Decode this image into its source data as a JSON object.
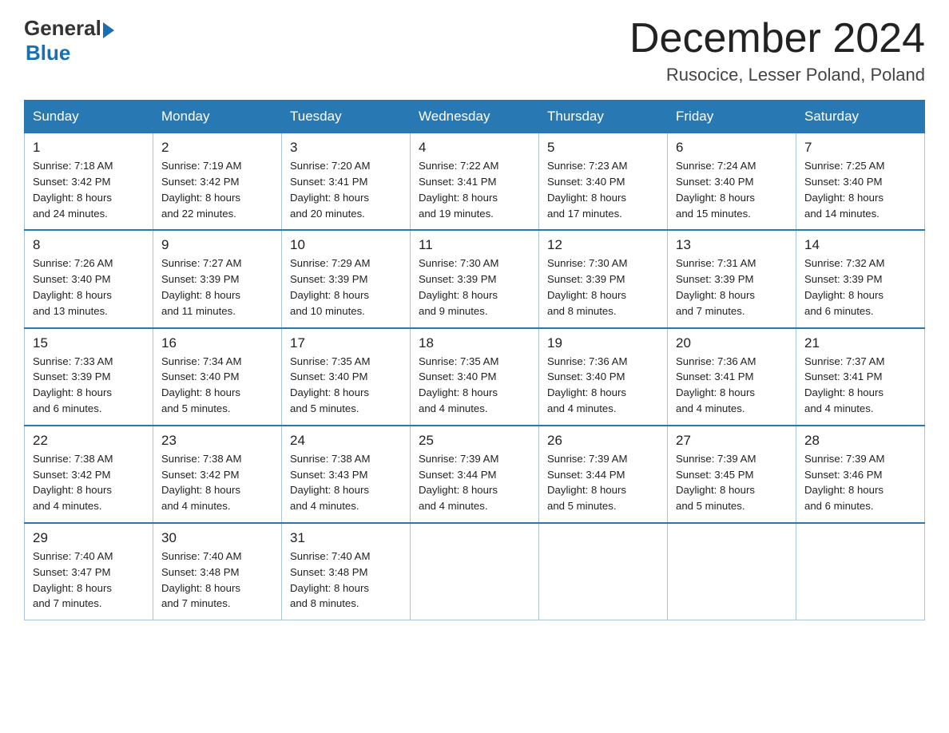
{
  "header": {
    "logo_general": "General",
    "logo_blue": "Blue",
    "title": "December 2024",
    "subtitle": "Rusocice, Lesser Poland, Poland"
  },
  "days_of_week": [
    "Sunday",
    "Monday",
    "Tuesday",
    "Wednesday",
    "Thursday",
    "Friday",
    "Saturday"
  ],
  "weeks": [
    [
      {
        "day": "1",
        "sunrise": "7:18 AM",
        "sunset": "3:42 PM",
        "daylight": "8 hours and 24 minutes."
      },
      {
        "day": "2",
        "sunrise": "7:19 AM",
        "sunset": "3:42 PM",
        "daylight": "8 hours and 22 minutes."
      },
      {
        "day": "3",
        "sunrise": "7:20 AM",
        "sunset": "3:41 PM",
        "daylight": "8 hours and 20 minutes."
      },
      {
        "day": "4",
        "sunrise": "7:22 AM",
        "sunset": "3:41 PM",
        "daylight": "8 hours and 19 minutes."
      },
      {
        "day": "5",
        "sunrise": "7:23 AM",
        "sunset": "3:40 PM",
        "daylight": "8 hours and 17 minutes."
      },
      {
        "day": "6",
        "sunrise": "7:24 AM",
        "sunset": "3:40 PM",
        "daylight": "8 hours and 15 minutes."
      },
      {
        "day": "7",
        "sunrise": "7:25 AM",
        "sunset": "3:40 PM",
        "daylight": "8 hours and 14 minutes."
      }
    ],
    [
      {
        "day": "8",
        "sunrise": "7:26 AM",
        "sunset": "3:40 PM",
        "daylight": "8 hours and 13 minutes."
      },
      {
        "day": "9",
        "sunrise": "7:27 AM",
        "sunset": "3:39 PM",
        "daylight": "8 hours and 11 minutes."
      },
      {
        "day": "10",
        "sunrise": "7:29 AM",
        "sunset": "3:39 PM",
        "daylight": "8 hours and 10 minutes."
      },
      {
        "day": "11",
        "sunrise": "7:30 AM",
        "sunset": "3:39 PM",
        "daylight": "8 hours and 9 minutes."
      },
      {
        "day": "12",
        "sunrise": "7:30 AM",
        "sunset": "3:39 PM",
        "daylight": "8 hours and 8 minutes."
      },
      {
        "day": "13",
        "sunrise": "7:31 AM",
        "sunset": "3:39 PM",
        "daylight": "8 hours and 7 minutes."
      },
      {
        "day": "14",
        "sunrise": "7:32 AM",
        "sunset": "3:39 PM",
        "daylight": "8 hours and 6 minutes."
      }
    ],
    [
      {
        "day": "15",
        "sunrise": "7:33 AM",
        "sunset": "3:39 PM",
        "daylight": "8 hours and 6 minutes."
      },
      {
        "day": "16",
        "sunrise": "7:34 AM",
        "sunset": "3:40 PM",
        "daylight": "8 hours and 5 minutes."
      },
      {
        "day": "17",
        "sunrise": "7:35 AM",
        "sunset": "3:40 PM",
        "daylight": "8 hours and 5 minutes."
      },
      {
        "day": "18",
        "sunrise": "7:35 AM",
        "sunset": "3:40 PM",
        "daylight": "8 hours and 4 minutes."
      },
      {
        "day": "19",
        "sunrise": "7:36 AM",
        "sunset": "3:40 PM",
        "daylight": "8 hours and 4 minutes."
      },
      {
        "day": "20",
        "sunrise": "7:36 AM",
        "sunset": "3:41 PM",
        "daylight": "8 hours and 4 minutes."
      },
      {
        "day": "21",
        "sunrise": "7:37 AM",
        "sunset": "3:41 PM",
        "daylight": "8 hours and 4 minutes."
      }
    ],
    [
      {
        "day": "22",
        "sunrise": "7:38 AM",
        "sunset": "3:42 PM",
        "daylight": "8 hours and 4 minutes."
      },
      {
        "day": "23",
        "sunrise": "7:38 AM",
        "sunset": "3:42 PM",
        "daylight": "8 hours and 4 minutes."
      },
      {
        "day": "24",
        "sunrise": "7:38 AM",
        "sunset": "3:43 PM",
        "daylight": "8 hours and 4 minutes."
      },
      {
        "day": "25",
        "sunrise": "7:39 AM",
        "sunset": "3:44 PM",
        "daylight": "8 hours and 4 minutes."
      },
      {
        "day": "26",
        "sunrise": "7:39 AM",
        "sunset": "3:44 PM",
        "daylight": "8 hours and 5 minutes."
      },
      {
        "day": "27",
        "sunrise": "7:39 AM",
        "sunset": "3:45 PM",
        "daylight": "8 hours and 5 minutes."
      },
      {
        "day": "28",
        "sunrise": "7:39 AM",
        "sunset": "3:46 PM",
        "daylight": "8 hours and 6 minutes."
      }
    ],
    [
      {
        "day": "29",
        "sunrise": "7:40 AM",
        "sunset": "3:47 PM",
        "daylight": "8 hours and 7 minutes."
      },
      {
        "day": "30",
        "sunrise": "7:40 AM",
        "sunset": "3:48 PM",
        "daylight": "8 hours and 7 minutes."
      },
      {
        "day": "31",
        "sunrise": "7:40 AM",
        "sunset": "3:48 PM",
        "daylight": "8 hours and 8 minutes."
      },
      null,
      null,
      null,
      null
    ]
  ],
  "labels": {
    "sunrise": "Sunrise:",
    "sunset": "Sunset:",
    "daylight": "Daylight:"
  }
}
